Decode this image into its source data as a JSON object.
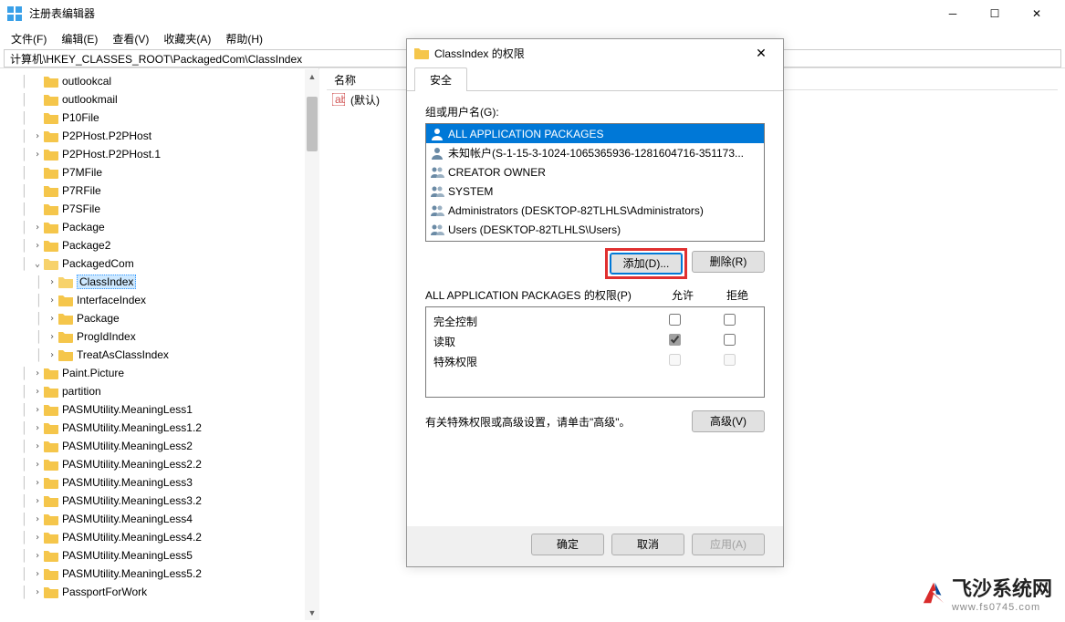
{
  "titlebar": {
    "title": "注册表编辑器"
  },
  "menu": {
    "file": "文件(F)",
    "edit": "编辑(E)",
    "view": "查看(V)",
    "fav": "收藏夹(A)",
    "help": "帮助(H)"
  },
  "address": "计算机\\HKEY_CLASSES_ROOT\\PackagedCom\\ClassIndex",
  "tree": [
    {
      "indent": 2,
      "exp": "",
      "label": "outlookcal"
    },
    {
      "indent": 2,
      "exp": "",
      "label": "outlookmail"
    },
    {
      "indent": 2,
      "exp": "",
      "label": "P10File"
    },
    {
      "indent": 2,
      "exp": ">",
      "label": "P2PHost.P2PHost"
    },
    {
      "indent": 2,
      "exp": ">",
      "label": "P2PHost.P2PHost.1"
    },
    {
      "indent": 2,
      "exp": "",
      "label": "P7MFile"
    },
    {
      "indent": 2,
      "exp": "",
      "label": "P7RFile"
    },
    {
      "indent": 2,
      "exp": "",
      "label": "P7SFile"
    },
    {
      "indent": 2,
      "exp": ">",
      "label": "Package"
    },
    {
      "indent": 2,
      "exp": ">",
      "label": "Package2"
    },
    {
      "indent": 2,
      "exp": "v",
      "label": "PackagedCom",
      "open": true
    },
    {
      "indent": 3,
      "exp": ">",
      "label": "ClassIndex",
      "open": true,
      "selected": true
    },
    {
      "indent": 3,
      "exp": ">",
      "label": "InterfaceIndex"
    },
    {
      "indent": 3,
      "exp": ">",
      "label": "Package"
    },
    {
      "indent": 3,
      "exp": ">",
      "label": "ProgIdIndex"
    },
    {
      "indent": 3,
      "exp": ">",
      "label": "TreatAsClassIndex"
    },
    {
      "indent": 2,
      "exp": ">",
      "label": "Paint.Picture"
    },
    {
      "indent": 2,
      "exp": ">",
      "label": "partition"
    },
    {
      "indent": 2,
      "exp": ">",
      "label": "PASMUtility.MeaningLess1"
    },
    {
      "indent": 2,
      "exp": ">",
      "label": "PASMUtility.MeaningLess1.2"
    },
    {
      "indent": 2,
      "exp": ">",
      "label": "PASMUtility.MeaningLess2"
    },
    {
      "indent": 2,
      "exp": ">",
      "label": "PASMUtility.MeaningLess2.2"
    },
    {
      "indent": 2,
      "exp": ">",
      "label": "PASMUtility.MeaningLess3"
    },
    {
      "indent": 2,
      "exp": ">",
      "label": "PASMUtility.MeaningLess3.2"
    },
    {
      "indent": 2,
      "exp": ">",
      "label": "PASMUtility.MeaningLess4"
    },
    {
      "indent": 2,
      "exp": ">",
      "label": "PASMUtility.MeaningLess4.2"
    },
    {
      "indent": 2,
      "exp": ">",
      "label": "PASMUtility.MeaningLess5"
    },
    {
      "indent": 2,
      "exp": ">",
      "label": "PASMUtility.MeaningLess5.2"
    },
    {
      "indent": 2,
      "exp": ">",
      "label": "PassportForWork"
    }
  ],
  "values": {
    "name_col": "名称",
    "default_name": "(默认)"
  },
  "dialog": {
    "title": "ClassIndex 的权限",
    "tab": "安全",
    "group_label": "组或用户名(G):",
    "users": [
      {
        "label": "ALL APPLICATION PACKAGES",
        "sel": true,
        "single": true
      },
      {
        "label": "未知帐户(S-1-15-3-1024-1065365936-1281604716-351173...",
        "single": true
      },
      {
        "label": "CREATOR OWNER"
      },
      {
        "label": "SYSTEM"
      },
      {
        "label": "Administrators (DESKTOP-82TLHLS\\Administrators)"
      },
      {
        "label": "Users (DESKTOP-82TLHLS\\Users)"
      }
    ],
    "add_btn": "添加(D)...",
    "remove_btn": "删除(R)",
    "perm_for": "ALL APPLICATION PACKAGES 的权限(P)",
    "allow": "允许",
    "deny": "拒绝",
    "perms": [
      {
        "name": "完全控制",
        "allow": false,
        "deny": false,
        "enabled": true
      },
      {
        "name": "读取",
        "allow": true,
        "deny": false,
        "enabled": true,
        "allow_gray": true
      },
      {
        "name": "特殊权限",
        "allow": false,
        "deny": false,
        "enabled": false
      }
    ],
    "adv_text": "有关特殊权限或高级设置，请单击\"高级\"。",
    "adv_btn": "高级(V)",
    "ok": "确定",
    "cancel": "取消",
    "apply": "应用(A)"
  },
  "watermark": {
    "brand": "飞沙系统网",
    "url": "www.fs0745.com"
  }
}
